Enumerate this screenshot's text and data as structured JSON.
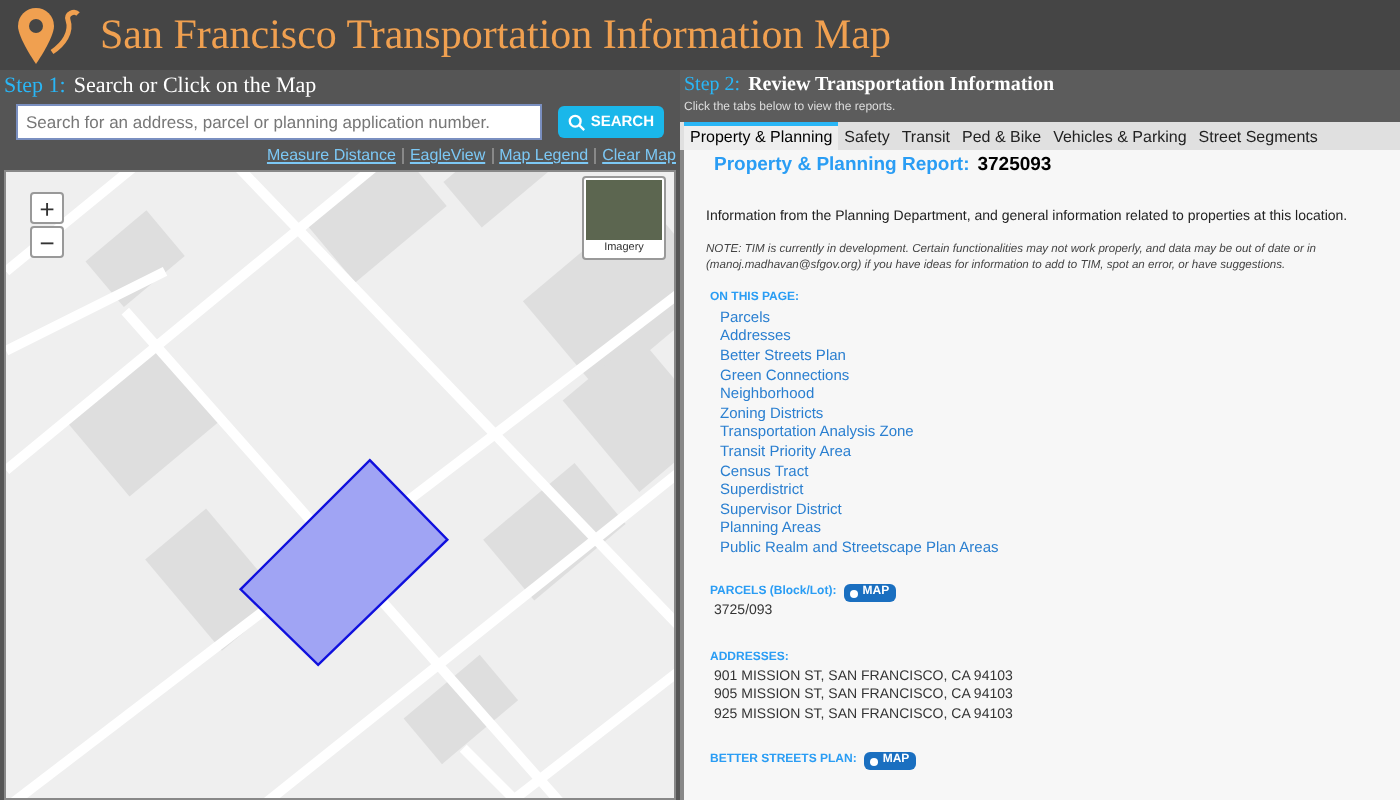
{
  "header": {
    "title": "San Francisco Transportation Information Map"
  },
  "step1": {
    "step": "Step 1:",
    "title": "Search or Click on the Map"
  },
  "search": {
    "placeholder": "Search for an address, parcel or planning application number.",
    "button": "SEARCH"
  },
  "map_links": [
    "Measure Distance",
    "EagleView",
    "Map Legend",
    "Clear Map"
  ],
  "map": {
    "zoom_in": "+",
    "zoom_out": "−",
    "basemap_label": "Imagery"
  },
  "step2": {
    "step": "Step 2:",
    "title": "Review Transportation Information",
    "subtitle": "Click the tabs below to view the reports."
  },
  "tabs": [
    {
      "label": "Property & Planning",
      "selected": true
    },
    {
      "label": "Safety",
      "selected": false
    },
    {
      "label": "Transit",
      "selected": false
    },
    {
      "label": "Ped & Bike",
      "selected": false
    },
    {
      "label": "Vehicles & Parking",
      "selected": false
    },
    {
      "label": "Street Segments",
      "selected": false
    }
  ],
  "report": {
    "title": "Property & Planning Report:",
    "id": "3725093",
    "intro": "Information from the Planning Department, and general information related to properties at this location.",
    "note": "NOTE: TIM is currently in development. Certain functionalities may not work properly, and data may be out of date or in (manoj.madhavan@sfgov.org) if you have ideas for information to add to TIM, spot an error, or have suggestions.",
    "on_this_page": "ON THIS PAGE:",
    "links": [
      "Parcels",
      "Addresses",
      "Better Streets Plan",
      "Green Connections",
      "Neighborhood",
      "Zoning Districts",
      "Transportation Analysis Zone",
      "Transit Priority Area",
      "Census Tract",
      "Superdistrict",
      "Supervisor District",
      "Planning Areas",
      "Public Realm and Streetscape Plan Areas"
    ],
    "sections": [
      {
        "heading": "PARCELS (Block/Lot):",
        "badge": "MAP",
        "lines": [
          "3725/093"
        ]
      },
      {
        "heading": "ADDRESSES:",
        "lines": [
          "901 MISSION ST, SAN FRANCISCO, CA 94103",
          "905 MISSION ST, SAN FRANCISCO, CA 94103",
          "925 MISSION ST, SAN FRANCISCO, CA 94103"
        ]
      },
      {
        "heading": "BETTER STREETS PLAN:",
        "badge": "MAP"
      }
    ]
  }
}
